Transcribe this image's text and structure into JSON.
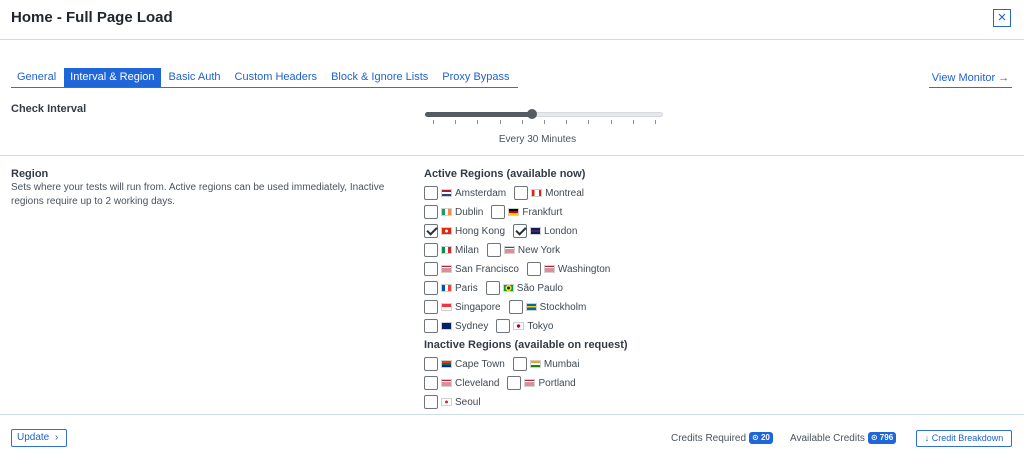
{
  "header": {
    "title": "Home - Full Page Load",
    "close_symbol": "×"
  },
  "tabs": [
    {
      "label": "General",
      "active": false
    },
    {
      "label": "Interval & Region",
      "active": true
    },
    {
      "label": "Basic Auth",
      "active": false
    },
    {
      "label": "Custom Headers",
      "active": false
    },
    {
      "label": "Block & Ignore Lists",
      "active": false
    },
    {
      "label": "Proxy Bypass",
      "active": false
    }
  ],
  "view_monitor": {
    "label": "View Monitor →"
  },
  "check_interval": {
    "label": "Check Interval",
    "value_text": "Every 30 Minutes",
    "slider_level": 0.45,
    "tick_count": 11
  },
  "region": {
    "label": "Region",
    "description": "Sets where your tests will run from. Active regions can be used immediately, Inactive regions require up to 2 working days."
  },
  "active_regions": {
    "heading": "Active Regions (available now)",
    "rows": [
      [
        {
          "name": "Amsterdam",
          "flag": "nl-flag",
          "checked": false
        },
        {
          "name": "Montreal",
          "flag": "ca-flag",
          "checked": false
        }
      ],
      [
        {
          "name": "Dublin",
          "flag": "ie-flag",
          "checked": false
        },
        {
          "name": "Frankfurt",
          "flag": "de-flag",
          "checked": false
        }
      ],
      [
        {
          "name": "Hong Kong",
          "flag": "hk-flag",
          "checked": true
        },
        {
          "name": "London",
          "flag": "gb-flag",
          "checked": true
        }
      ],
      [
        {
          "name": "Milan",
          "flag": "it-flag",
          "checked": false
        },
        {
          "name": "New York",
          "flag": "us-flag",
          "checked": false
        }
      ],
      [
        {
          "name": "San Francisco",
          "flag": "us-flag",
          "checked": false
        },
        {
          "name": "Washington",
          "flag": "us-flag",
          "checked": false
        }
      ],
      [
        {
          "name": "Paris",
          "flag": "fr-flag",
          "checked": false
        },
        {
          "name": "São Paulo",
          "flag": "br-flag",
          "checked": false
        }
      ],
      [
        {
          "name": "Singapore",
          "flag": "sg-flag",
          "checked": false
        },
        {
          "name": "Stockholm",
          "flag": "se-flag",
          "checked": false
        }
      ],
      [
        {
          "name": "Sydney",
          "flag": "au-flag",
          "checked": false
        },
        {
          "name": "Tokyo",
          "flag": "jp-flag",
          "checked": false
        }
      ]
    ]
  },
  "inactive_regions": {
    "heading": "Inactive Regions (available on request)",
    "rows": [
      [
        {
          "name": "Cape Town",
          "flag": "za-flag",
          "checked": false
        },
        {
          "name": "Mumbai",
          "flag": "in-flag",
          "checked": false
        }
      ],
      [
        {
          "name": "Cleveland",
          "flag": "us-flag",
          "checked": false
        },
        {
          "name": "Portland",
          "flag": "us-flag",
          "checked": false
        }
      ],
      [
        {
          "name": "Seoul",
          "flag": "kr-flag",
          "checked": false
        }
      ]
    ]
  },
  "footer": {
    "update_label": "Update",
    "credits_required_label": "Credits Required",
    "credits_required_value": "20",
    "available_credits_label": "Available Credits",
    "available_credits_value": "796",
    "credit_breakdown_label": "↓ Credit Breakdown"
  },
  "colors": {
    "accent": "#1f66d8",
    "divider": "#cfdde9"
  }
}
